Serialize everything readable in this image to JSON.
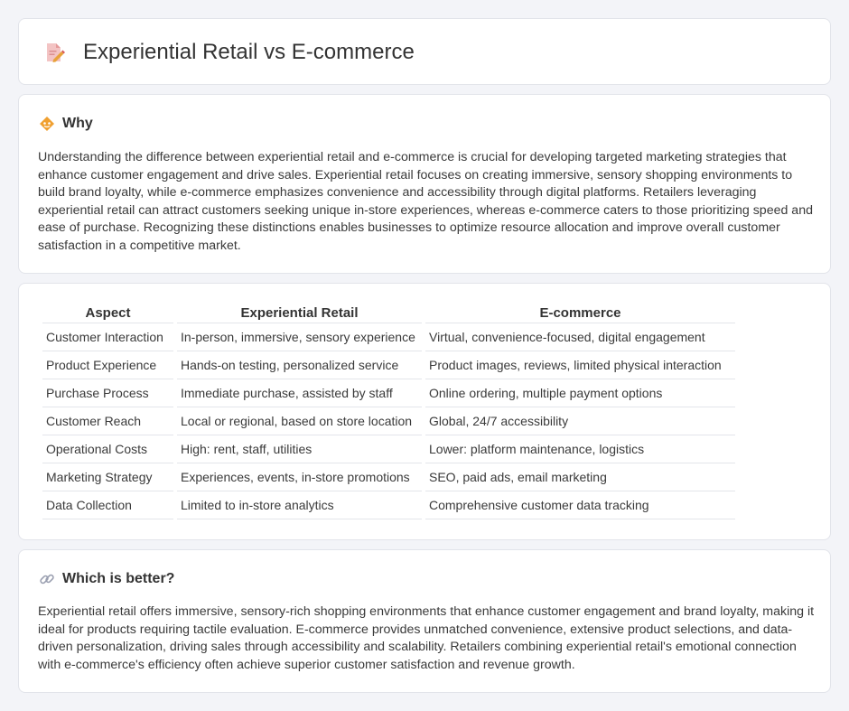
{
  "header": {
    "title": "Experiential Retail vs E-commerce",
    "icon": "document-pencil-icon"
  },
  "why": {
    "title": "Why",
    "icon": "diamond-warning-icon",
    "text": "Understanding the difference between experiential retail and e-commerce is crucial for developing targeted marketing strategies that enhance customer engagement and drive sales. Experiential retail focuses on creating immersive, sensory shopping environments to build brand loyalty, while e-commerce emphasizes convenience and accessibility through digital platforms. Retailers leveraging experiential retail can attract customers seeking unique in-store experiences, whereas e-commerce caters to those prioritizing speed and ease of purchase. Recognizing these distinctions enables businesses to optimize resource allocation and improve overall customer satisfaction in a competitive market."
  },
  "table": {
    "headers": [
      "Aspect",
      "Experiential Retail",
      "E-commerce"
    ],
    "rows": [
      [
        "Customer Interaction",
        "In-person, immersive, sensory experience",
        "Virtual, convenience-focused, digital engagement"
      ],
      [
        "Product Experience",
        "Hands-on testing, personalized service",
        "Product images, reviews, limited physical interaction"
      ],
      [
        "Purchase Process",
        "Immediate purchase, assisted by staff",
        "Online ordering, multiple payment options"
      ],
      [
        "Customer Reach",
        "Local or regional, based on store location",
        "Global, 24/7 accessibility"
      ],
      [
        "Operational Costs",
        "High: rent, staff, utilities",
        "Lower: platform maintenance, logistics"
      ],
      [
        "Marketing Strategy",
        "Experiences, events, in-store promotions",
        "SEO, paid ads, email marketing"
      ],
      [
        "Data Collection",
        "Limited to in-store analytics",
        "Comprehensive customer data tracking"
      ]
    ]
  },
  "better": {
    "title": "Which is better?",
    "icon": "link-icon",
    "text": "Experiential retail offers immersive, sensory-rich shopping environments that enhance customer engagement and brand loyalty, making it ideal for products requiring tactile evaluation. E-commerce provides unmatched convenience, extensive product selections, and data-driven personalization, driving sales through accessibility and scalability. Retailers combining experiential retail's emotional connection with e-commerce's efficiency often achieve superior customer satisfaction and revenue growth."
  },
  "colors": {
    "background": "#f3f4f8",
    "card": "#ffffff",
    "border": "#e2e4ea",
    "accent": "#f0a030"
  }
}
